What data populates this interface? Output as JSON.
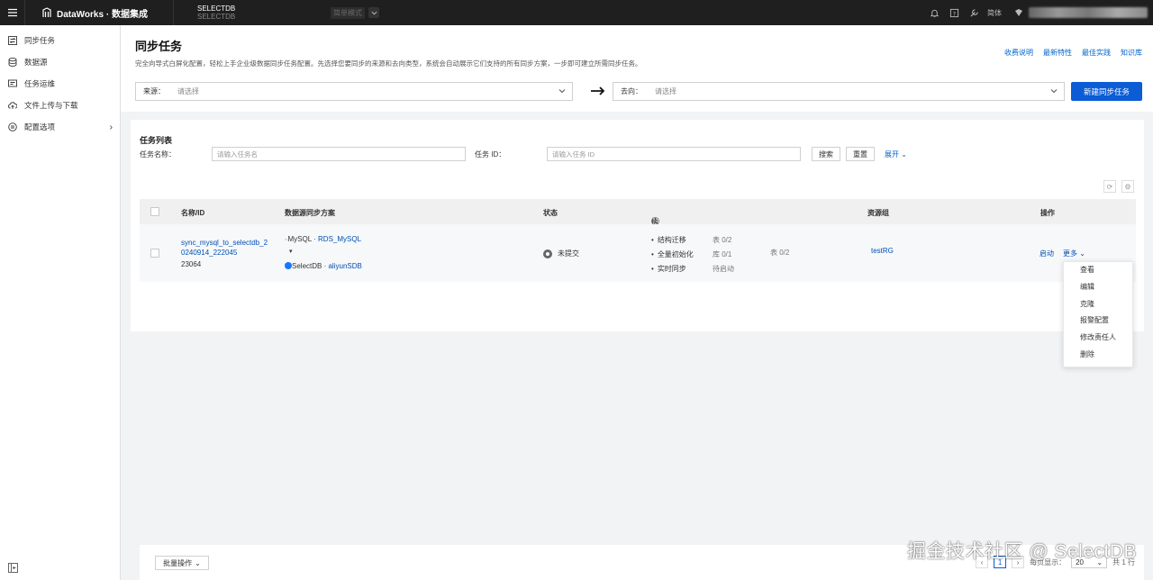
{
  "topbar": {
    "brand": "DataWorks · 数据集成",
    "workspace_name": "SELECTDB",
    "workspace_sub": "SELECTDB",
    "mode_label": "简单模式",
    "lang": "简体"
  },
  "sidebar": {
    "items": [
      {
        "label": "同步任务",
        "icon": "sync-icon"
      },
      {
        "label": "数据源",
        "icon": "database-icon"
      },
      {
        "label": "任务运维",
        "icon": "monitor-icon"
      },
      {
        "label": "文件上传与下载",
        "icon": "cloud-upload-icon"
      },
      {
        "label": "配置选项",
        "icon": "settings-icon"
      }
    ]
  },
  "header": {
    "title": "同步任务",
    "description": "完全向导式白屏化配置，轻松上手企业级数据同步任务配置。先选择您要同步的来源和去向类型，系统会自动展示它们支持的所有同步方案，一步即可建立所需同步任务。",
    "links": [
      "收费说明",
      "最新特性",
      "最佳实践",
      "知识库"
    ],
    "source_label": "来源：",
    "source_placeholder": "请选择",
    "target_label": "去向：",
    "target_placeholder": "请选择",
    "new_button": "新建同步任务"
  },
  "task_list": {
    "title": "任务列表",
    "name_label": "任务名称：",
    "name_placeholder": "请输入任务名",
    "id_label": "任务 ID：",
    "id_placeholder": "请输入任务 ID",
    "search": "搜索",
    "reset": "重置",
    "expand": "展开",
    "columns": [
      "名称/ID",
      "数据源同步方案",
      "状态",
      "执行概况",
      "资源组",
      "操作"
    ],
    "row": {
      "name_line1": "sync_mysql_to_selectdb_2",
      "name_line2": "0240914_222045",
      "id": "23064",
      "source_type": "MySQL",
      "source_name": "RDS_MySQL",
      "target_type": "SelectDB",
      "target_name": "aliyunSDB",
      "status": "未提交",
      "exec": [
        {
          "label": "结构迁移",
          "v1": "表 0/2",
          "v2": ""
        },
        {
          "label": "全量初始化",
          "v1": "库 0/1",
          "v2": "表 0/2"
        },
        {
          "label": "实时同步",
          "v1": "待启动",
          "v2": ""
        }
      ],
      "resource_group": "testRG",
      "action_start": "启动",
      "action_more": "更多"
    },
    "more_menu": [
      "查看",
      "编辑",
      "克隆",
      "报警配置",
      "修改责任人",
      "删除"
    ]
  },
  "footer": {
    "batch": "批量操作",
    "page": "1",
    "per_page_label": "每页显示：",
    "per_page": "20",
    "total": "共 1 行"
  },
  "watermark": "掘金技术社区 @ SelectDB",
  "colors": {
    "accent": "#0b5cd5",
    "link": "#0050b3",
    "topbar": "#1f1f1f"
  }
}
